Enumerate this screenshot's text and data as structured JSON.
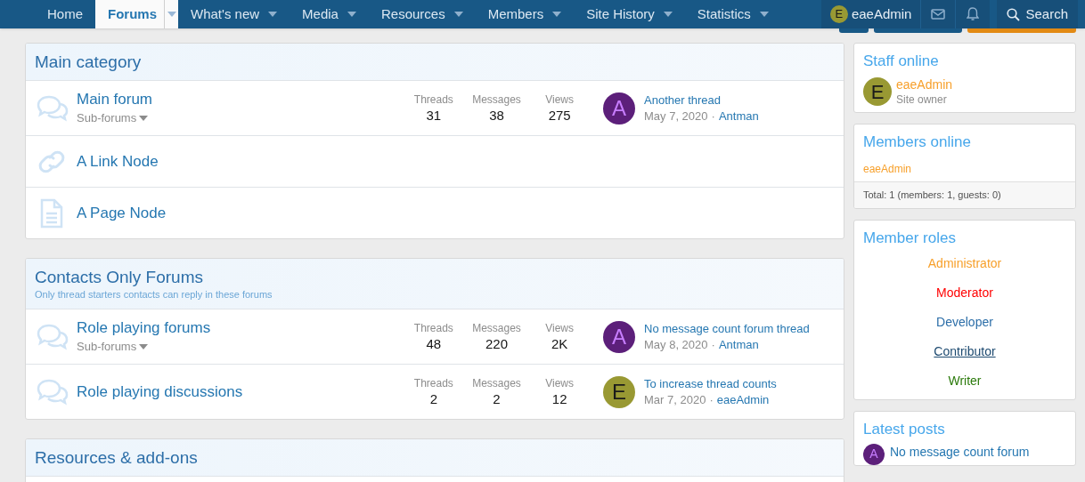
{
  "nav": {
    "items": [
      {
        "label": "Home",
        "selected": false,
        "has_menu": false
      },
      {
        "label": "Forums",
        "selected": true,
        "has_menu": true
      },
      {
        "label": "What's new",
        "selected": false,
        "has_menu": true
      },
      {
        "label": "Media",
        "selected": false,
        "has_menu": true
      },
      {
        "label": "Resources",
        "selected": false,
        "has_menu": true
      },
      {
        "label": "Members",
        "selected": false,
        "has_menu": true
      },
      {
        "label": "Site History",
        "selected": false,
        "has_menu": true
      },
      {
        "label": "Statistics",
        "selected": false,
        "has_menu": true
      }
    ],
    "user": {
      "avatar": "E",
      "color": "#999933",
      "name": "eaeAdmin"
    },
    "search": "Search"
  },
  "categories": [
    {
      "title": "Main category",
      "forums": [
        {
          "kind": "forum",
          "title": "Main forum",
          "subforums": "Sub-forums",
          "stats": [
            {
              "label": "Threads",
              "value": "31"
            },
            {
              "label": "Messages",
              "value": "38"
            },
            {
              "label": "Views",
              "value": "275"
            }
          ],
          "last_post": {
            "avatar": "A",
            "color": "#5c1f7a",
            "title": "Another thread",
            "date": "May 7, 2020",
            "separator": "·",
            "author": "Antman"
          }
        },
        {
          "kind": "link",
          "title": "A Link Node"
        },
        {
          "kind": "page",
          "title": "A Page Node"
        }
      ]
    },
    {
      "title": "Contacts Only Forums",
      "description": "Only thread starters contacts can reply in these forums",
      "forums": [
        {
          "kind": "forum",
          "title": "Role playing forums",
          "subforums": "Sub-forums",
          "stats": [
            {
              "label": "Threads",
              "value": "48"
            },
            {
              "label": "Messages",
              "value": "220"
            },
            {
              "label": "Views",
              "value": "2K"
            }
          ],
          "last_post": {
            "avatar": "A",
            "color": "#5c1f7a",
            "title": "No message count forum thread",
            "date": "May 8, 2020",
            "separator": "·",
            "author": "Antman"
          }
        },
        {
          "kind": "forum",
          "title": "Role playing discussions",
          "stats": [
            {
              "label": "Threads",
              "value": "2"
            },
            {
              "label": "Messages",
              "value": "2"
            },
            {
              "label": "Views",
              "value": "12"
            }
          ],
          "last_post": {
            "avatar": "E",
            "color": "#999933",
            "title": "To increase thread counts",
            "date": "Mar 7, 2020",
            "separator": "·",
            "author": "eaeAdmin"
          }
        }
      ]
    },
    {
      "title": "Resources & add-ons"
    }
  ],
  "sidebar": {
    "staff_online": {
      "title": "Staff online",
      "members": [
        {
          "avatar": "E",
          "color": "#999933",
          "name": "eaeAdmin",
          "role": "Site owner"
        }
      ]
    },
    "members_online": {
      "title": "Members online",
      "members": [
        "eaeAdmin"
      ],
      "total": "Total: 1 (members: 1, guests: 0)"
    },
    "member_roles": {
      "title": "Member roles",
      "roles": [
        {
          "label": "Administrator",
          "color": "#f7a02b",
          "underline": false
        },
        {
          "label": "Moderator",
          "color": "#ff0000",
          "underline": false
        },
        {
          "label": "Developer",
          "color": "#2c6ea8",
          "underline": false
        },
        {
          "label": "Contributor",
          "color": "#1d4a70",
          "underline": true
        },
        {
          "label": "Writer",
          "color": "#2b7a0b",
          "underline": false
        }
      ]
    },
    "latest_posts": {
      "title": "Latest posts",
      "posts": [
        {
          "avatar": "A",
          "color": "#5c1f7a",
          "title": "No message count forum"
        }
      ]
    }
  }
}
